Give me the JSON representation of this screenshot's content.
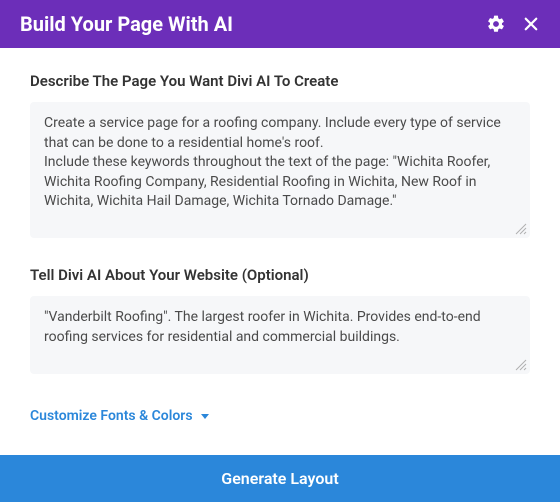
{
  "header": {
    "title": "Build Your Page With AI"
  },
  "describe": {
    "label": "Describe The Page You Want Divi AI To Create",
    "value": "Create a service page for a roofing company. Include every type of service that can be done to a residential home's roof.\nInclude these keywords throughout the text of the page: \"Wichita Roofer, Wichita Roofing Company, Residential Roofing in Wichita, New Roof in Wichita, Wichita Hail Damage, Wichita Tornado Damage.\""
  },
  "about": {
    "label": "Tell Divi AI About Your Website (Optional)",
    "value": "\"Vanderbilt Roofing\". The largest roofer in Wichita. Provides end-to-end roofing services for residential and commercial buildings."
  },
  "customize": {
    "label": "Customize Fonts & Colors"
  },
  "footer": {
    "generate_label": "Generate Layout"
  }
}
